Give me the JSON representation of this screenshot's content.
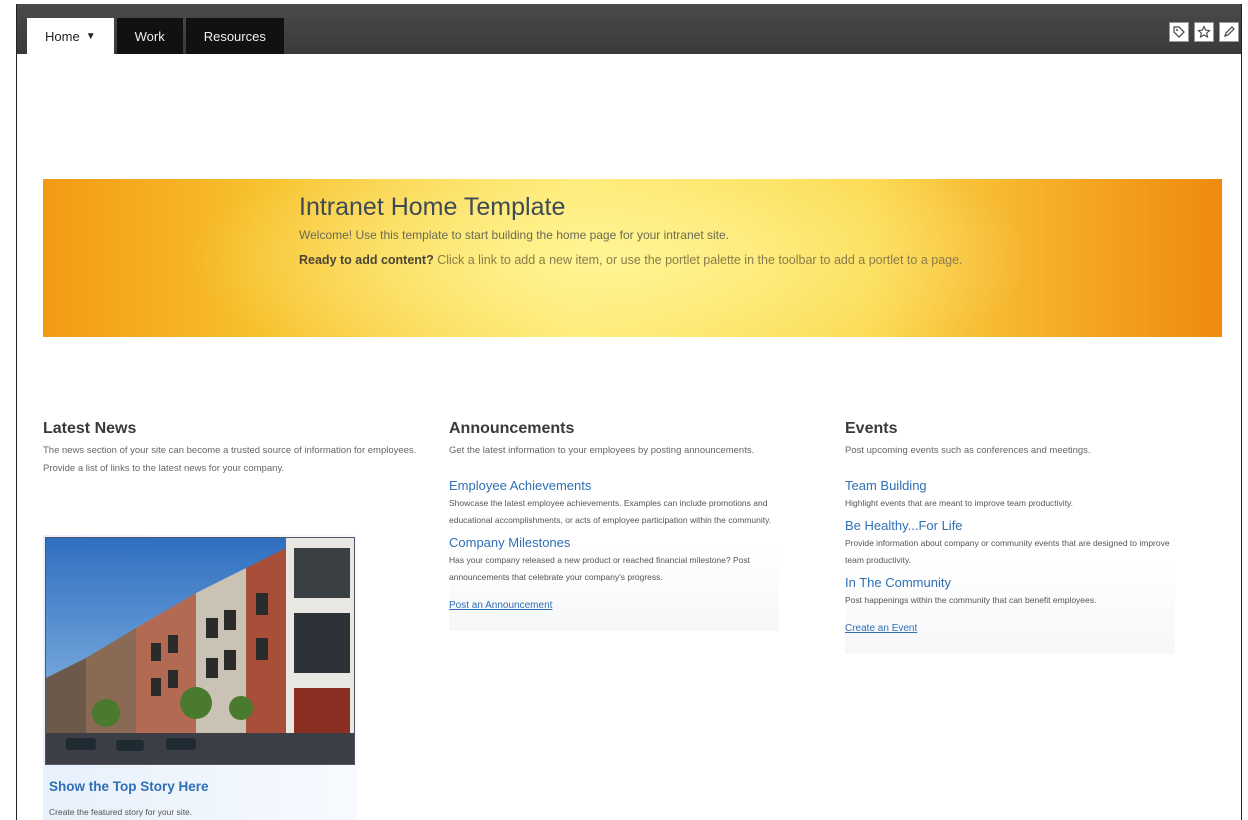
{
  "nav": {
    "tabs": [
      {
        "label": "Home",
        "active": true
      },
      {
        "label": "Work",
        "active": false
      },
      {
        "label": "Resources",
        "active": false
      }
    ],
    "tools": [
      "tag-icon",
      "star-icon",
      "pencil-icon"
    ]
  },
  "banner": {
    "title": "Intranet Home Template",
    "welcome": "Welcome! Use this template to start building the home page for your intranet site.",
    "ready_bold": "Ready to add content?",
    "ready_text": " Click a link to add a new item, or use the portlet palette in the toolbar to add a portlet to a page."
  },
  "news": {
    "title": "Latest News",
    "desc": "The news section of your site can become a trusted source of information for employees. Provide a list of links to the latest news for your company.",
    "story_title": "Show the Top Story Here",
    "story_sub": "Create the featured story for your site."
  },
  "announcements": {
    "title": "Announcements",
    "desc": "Get the latest information to your employees by posting announcements.",
    "items": [
      {
        "title": "Employee Achievements",
        "text": "Showcase the latest employee achievements. Examples can include promotions and educational accomplishments, or acts of employee participation within the community."
      },
      {
        "title": "Company Milestones",
        "text": "Has your company released a new product or reached financial milestone? Post announcements that celebrate your company's progress."
      }
    ],
    "link": "Post an Announcement"
  },
  "events": {
    "title": "Events",
    "desc": "Post upcoming events such as conferences and meetings.",
    "items": [
      {
        "title": "Team Building",
        "text": "Highlight events that are meant to improve team productivity."
      },
      {
        "title": "Be Healthy...For Life",
        "text": "Provide information about company or community events that are designed to improve team productivity."
      },
      {
        "title": "In The Community",
        "text": "Post happenings within the community that can benefit employees."
      }
    ],
    "link": "Create an Event"
  }
}
